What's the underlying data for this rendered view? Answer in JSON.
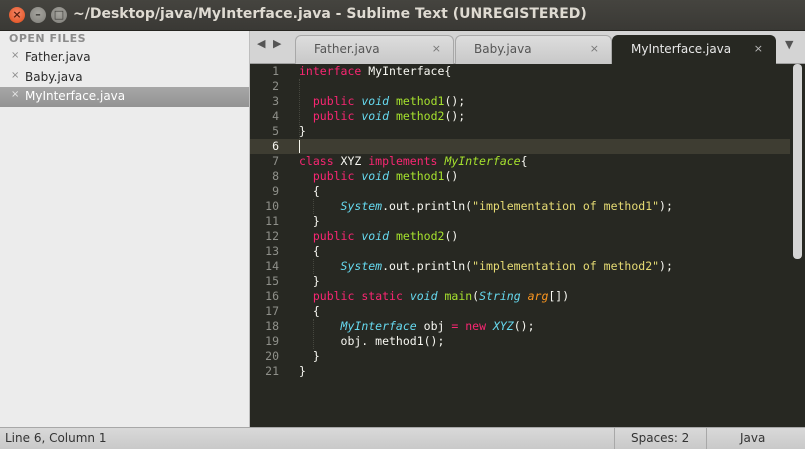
{
  "window": {
    "title": "~/Desktop/java/MyInterface.java - Sublime Text (UNREGISTERED)",
    "controls": {
      "close": "×",
      "minimize": "–",
      "maximize": "□"
    }
  },
  "sidebar": {
    "header": "OPEN FILES",
    "close_glyph": "×",
    "items": [
      {
        "label": "Father.java",
        "active": false
      },
      {
        "label": "Baby.java",
        "active": false
      },
      {
        "label": "MyInterface.java",
        "active": true
      }
    ]
  },
  "tabs": {
    "prev_glyph": "◀",
    "next_glyph": "▶",
    "menu_glyph": "▼",
    "close_glyph": "×",
    "items": [
      {
        "label": "Father.java",
        "active": false
      },
      {
        "label": "Baby.java",
        "active": false
      },
      {
        "label": "MyInterface.java",
        "active": true
      }
    ]
  },
  "editor": {
    "current_line": 6,
    "line_numbers": [
      "1",
      "2",
      "3",
      "4",
      "5",
      "6",
      "7",
      "8",
      "9",
      "10",
      "11",
      "12",
      "13",
      "14",
      "15",
      "16",
      "17",
      "18",
      "19",
      "20",
      "21"
    ],
    "lines": [
      [
        [
          "kw",
          "interface"
        ],
        [
          "plain",
          " MyInterface{"
        ]
      ],
      [],
      [
        [
          "plain",
          "  "
        ],
        [
          "kw",
          "public"
        ],
        [
          "plain",
          " "
        ],
        [
          "st",
          "void"
        ],
        [
          "plain",
          " "
        ],
        [
          "fn",
          "method1"
        ],
        [
          "plain",
          "();"
        ]
      ],
      [
        [
          "plain",
          "  "
        ],
        [
          "kw",
          "public"
        ],
        [
          "plain",
          " "
        ],
        [
          "st",
          "void"
        ],
        [
          "plain",
          " "
        ],
        [
          "fn",
          "method2"
        ],
        [
          "plain",
          "();"
        ]
      ],
      [
        [
          "plain",
          "}"
        ]
      ],
      [],
      [
        [
          "kw",
          "class"
        ],
        [
          "plain",
          " XYZ "
        ],
        [
          "kw",
          "implements"
        ],
        [
          "plain",
          " "
        ],
        [
          "ifn",
          "MyInterface"
        ],
        [
          "plain",
          "{"
        ]
      ],
      [
        [
          "plain",
          "  "
        ],
        [
          "kw",
          "public"
        ],
        [
          "plain",
          " "
        ],
        [
          "st",
          "void"
        ],
        [
          "plain",
          " "
        ],
        [
          "fn",
          "method1"
        ],
        [
          "plain",
          "()"
        ]
      ],
      [
        [
          "plain",
          "  {"
        ]
      ],
      [
        [
          "plain",
          "      "
        ],
        [
          "st",
          "System"
        ],
        [
          "plain",
          ".out.println("
        ],
        [
          "str",
          "\"implementation of method1\""
        ],
        [
          "plain",
          ");"
        ]
      ],
      [
        [
          "plain",
          "  }"
        ]
      ],
      [
        [
          "plain",
          "  "
        ],
        [
          "kw",
          "public"
        ],
        [
          "plain",
          " "
        ],
        [
          "st",
          "void"
        ],
        [
          "plain",
          " "
        ],
        [
          "fn",
          "method2"
        ],
        [
          "plain",
          "()"
        ]
      ],
      [
        [
          "plain",
          "  {"
        ]
      ],
      [
        [
          "plain",
          "      "
        ],
        [
          "st",
          "System"
        ],
        [
          "plain",
          ".out.println("
        ],
        [
          "str",
          "\"implementation of method2\""
        ],
        [
          "plain",
          ");"
        ]
      ],
      [
        [
          "plain",
          "  }"
        ]
      ],
      [
        [
          "plain",
          "  "
        ],
        [
          "kw",
          "public"
        ],
        [
          "plain",
          " "
        ],
        [
          "kw",
          "static"
        ],
        [
          "plain",
          " "
        ],
        [
          "st",
          "void"
        ],
        [
          "plain",
          " "
        ],
        [
          "fn",
          "main"
        ],
        [
          "plain",
          "("
        ],
        [
          "st",
          "String"
        ],
        [
          "plain",
          " "
        ],
        [
          "par",
          "arg"
        ],
        [
          "plain",
          "[])"
        ]
      ],
      [
        [
          "plain",
          "  {"
        ]
      ],
      [
        [
          "plain",
          "      "
        ],
        [
          "st",
          "MyInterface"
        ],
        [
          "plain",
          " obj "
        ],
        [
          "kw",
          "="
        ],
        [
          "plain",
          " "
        ],
        [
          "kw",
          "new"
        ],
        [
          "plain",
          " "
        ],
        [
          "st",
          "XYZ"
        ],
        [
          "plain",
          "();"
        ]
      ],
      [
        [
          "plain",
          "      obj. method1();"
        ]
      ],
      [
        [
          "plain",
          "  }"
        ]
      ],
      [
        [
          "plain",
          "}"
        ]
      ]
    ]
  },
  "status": {
    "position": "Line 6, Column 1",
    "indentation": "Spaces: 2",
    "syntax": "Java"
  },
  "colors": {
    "editor_bg": "#272822",
    "keyword": "#f92672",
    "storage": "#66d9ef",
    "function": "#a6e22e",
    "string": "#e6db74",
    "parameter": "#fd971f"
  }
}
